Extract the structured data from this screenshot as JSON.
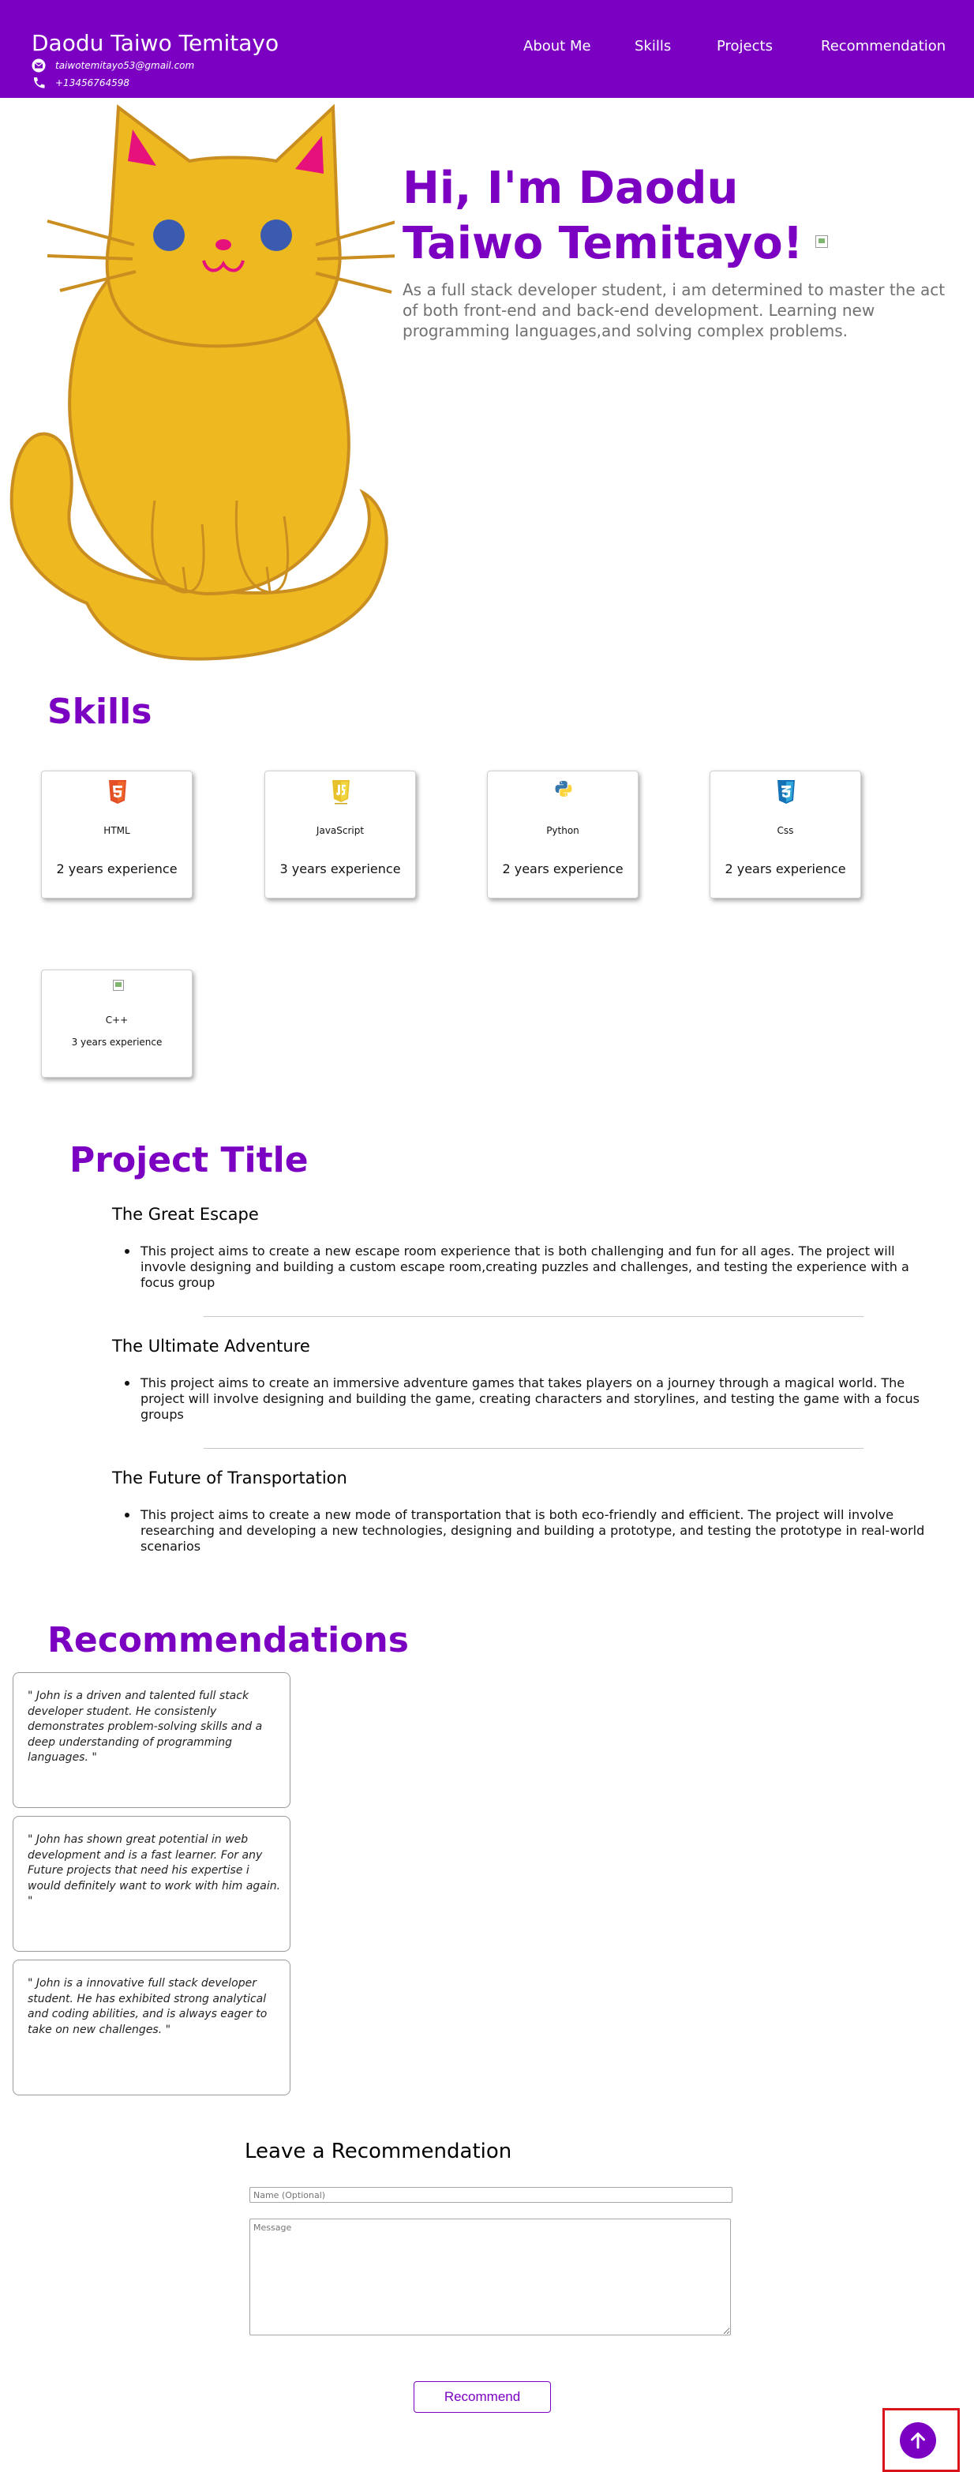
{
  "header": {
    "name": "Daodu Taiwo Temitayo",
    "email": "taiwotemitayo53@gmail.com",
    "phone": "+13456764598",
    "nav": [
      "About Me",
      "Skills",
      "Projects",
      "Recommendation"
    ]
  },
  "hero": {
    "title": "Hi, I'm Daodu Taiwo Temitayo!",
    "subtitle": "As a full stack developer student, i am determined to master the act of both front-end and back-end development. Learning new programming languages,and solving complex problems."
  },
  "skills": {
    "title": "Skills",
    "items": [
      {
        "name": "HTML",
        "experience": "2 years experience",
        "icon": "html5-icon"
      },
      {
        "name": "JavaScript",
        "experience": "3 years experience",
        "icon": "javascript-icon"
      },
      {
        "name": "Python",
        "experience": "2 years experience",
        "icon": "python-icon"
      },
      {
        "name": "Css",
        "experience": "2 years experience",
        "icon": "css3-icon"
      },
      {
        "name": "C++",
        "experience": "3 years experience",
        "icon": "broken-image-icon"
      }
    ]
  },
  "projects": {
    "title": "Project Title",
    "items": [
      {
        "name": "The Great Escape",
        "description": "This project aims to create a new escape room experience that is both challenging and fun for all ages. The project will invovle designing and building a custom escape room,creating puzzles and challenges, and testing the experience with a focus group"
      },
      {
        "name": "The Ultimate Adventure",
        "description": "This project aims to create an immersive adventure games that takes players on a journey through a magical world. The project will involve designing and building the game, creating characters and storylines, and testing the game with a focus groups"
      },
      {
        "name": "The Future of Transportation",
        "description": "This project aims to create a new mode of transportation that is both eco-friendly and efficient. The project will involve researching and developing a new technologies, designing and building a prototype, and testing the prototype in real-world scenarios"
      }
    ]
  },
  "recommendations": {
    "title": "Recommendations",
    "items": [
      "\" John is a driven and talented full stack developer student. He consistenly demonstrates problem-solving skills and a deep understanding of programming languages. \"",
      "\" John has shown great potential in web development and is a fast learner. For any Future projects that need his expertise i would definitely want to work with him again. \"",
      "\" John is a innovative full stack developer student. He has exhibited strong analytical and coding abilities, and is always eager to take on new challenges. \""
    ]
  },
  "form": {
    "title": "Leave a Recommendation",
    "name_placeholder": "Name (Optional)",
    "message_placeholder": "Message",
    "submit_label": "Recommend"
  },
  "colors": {
    "brand_purple": "#7b00c2",
    "highlight_red": "#d9151b",
    "cat_fill": "#edb820"
  }
}
